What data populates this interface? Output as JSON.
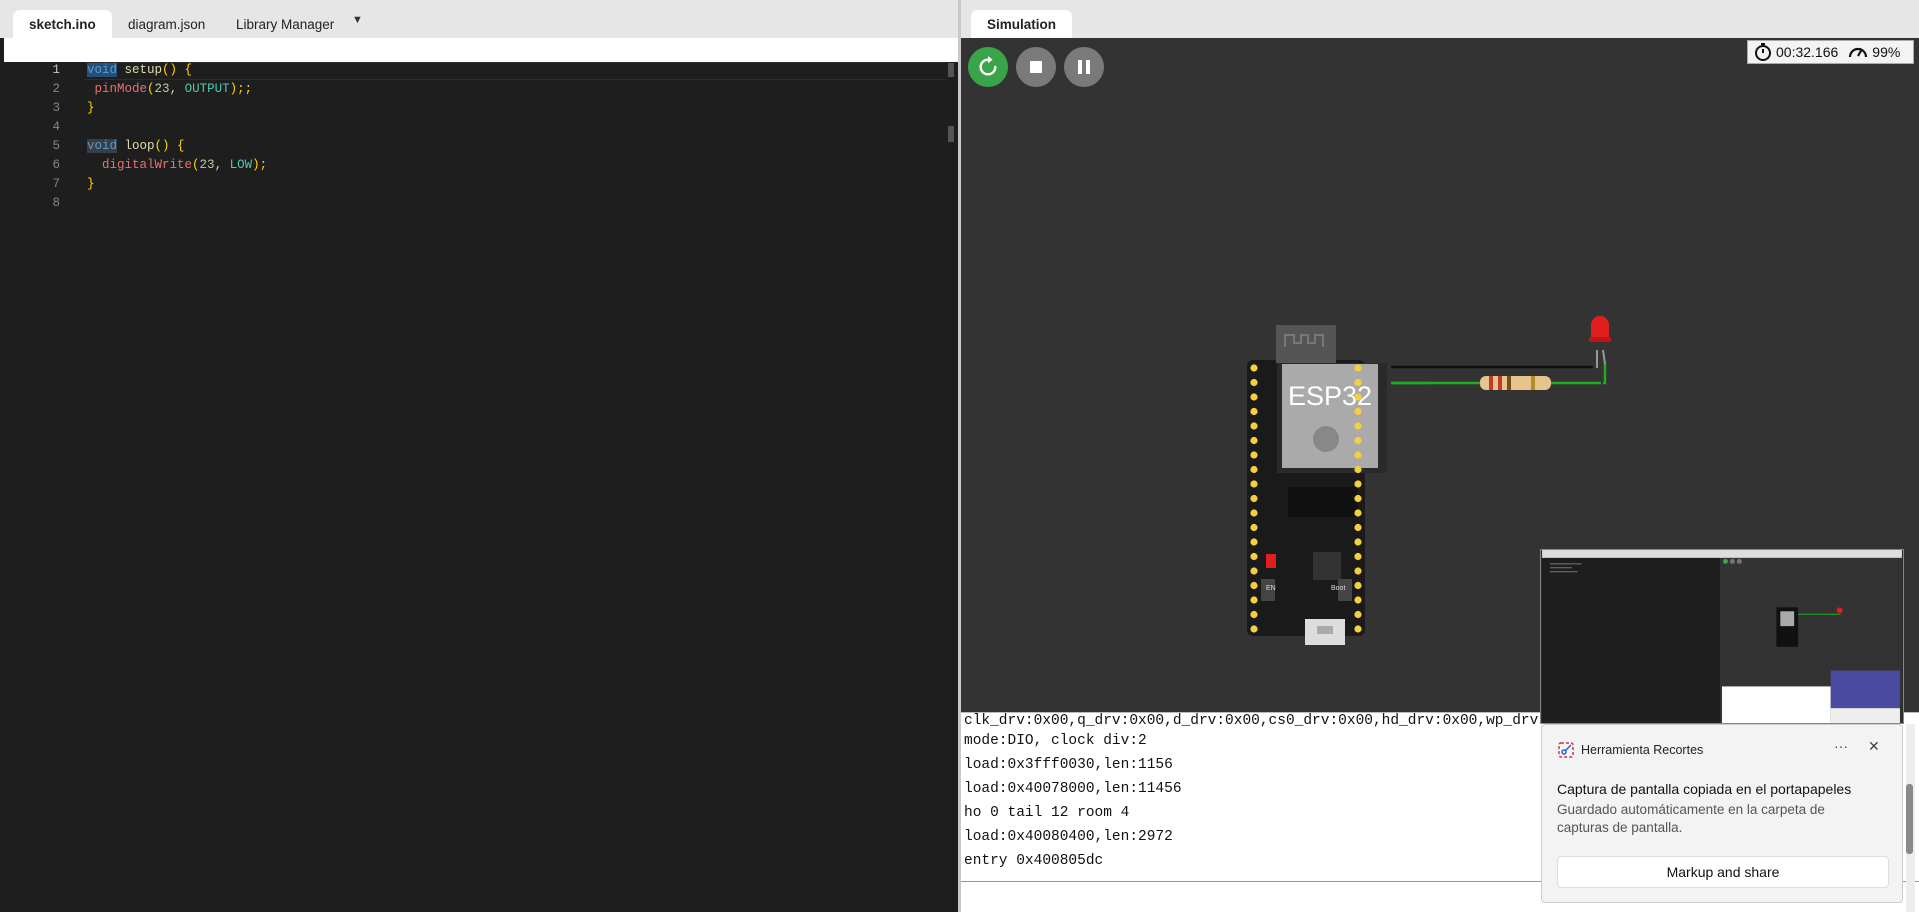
{
  "editor": {
    "tabs": [
      {
        "label": "sketch.ino",
        "active": true
      },
      {
        "label": "diagram.json",
        "active": false
      },
      {
        "label": "Library Manager",
        "active": false
      }
    ],
    "line_numbers": [
      "1",
      "2",
      "3",
      "4",
      "5",
      "6",
      "7",
      "8"
    ],
    "code": {
      "l1_kw": "void",
      "l1_fn": "setup",
      "l1_rest": "() {",
      "l2_fn": "pinMode",
      "l2_open": "(",
      "l2_num": "23",
      "l2_sep": ", ",
      "l2_const": "OUTPUT",
      "l2_close": ");;",
      "l3": "}",
      "l5_kw": "void",
      "l5_fn": "loop",
      "l5_rest": "() {",
      "l6_fn": "digitalWrite",
      "l6_open": "(",
      "l6_num": "23",
      "l6_sep": ", ",
      "l6_const": "LOW",
      "l6_close": ");",
      "l7": "}"
    }
  },
  "simulation": {
    "tab_label": "Simulation",
    "controls": [
      "restart-icon",
      "stop-icon",
      "pause-icon"
    ],
    "timer": "00:32.166",
    "speed": "99%",
    "board_label": "ESP32",
    "boot_label": "Boot",
    "en_label": "EN"
  },
  "serial": {
    "lines": [
      "clk_drv:0x00,q_drv:0x00,d_drv:0x00,cs0_drv:0x00,hd_drv:0x00,wp_drv:0x00",
      "mode:DIO, clock div:2",
      "load:0x3fff0030,len:1156",
      "load:0x40078000,len:11456",
      "ho 0 tail 12 room 4",
      "load:0x40080400,len:2972",
      "entry 0x400805dc"
    ]
  },
  "notification": {
    "app_name": "Herramienta Recortes",
    "more": "···",
    "close": "✕",
    "title": "Captura de pantalla copiada en el portapapeles",
    "body": "Guardado automáticamente en la carpeta de capturas de pantalla.",
    "action": "Markup and share"
  },
  "colors": {
    "accent_green": "#3aa44a",
    "editor_bg": "#1e1e1e",
    "sim_bg": "#333333",
    "led_red": "#e11e1e"
  }
}
